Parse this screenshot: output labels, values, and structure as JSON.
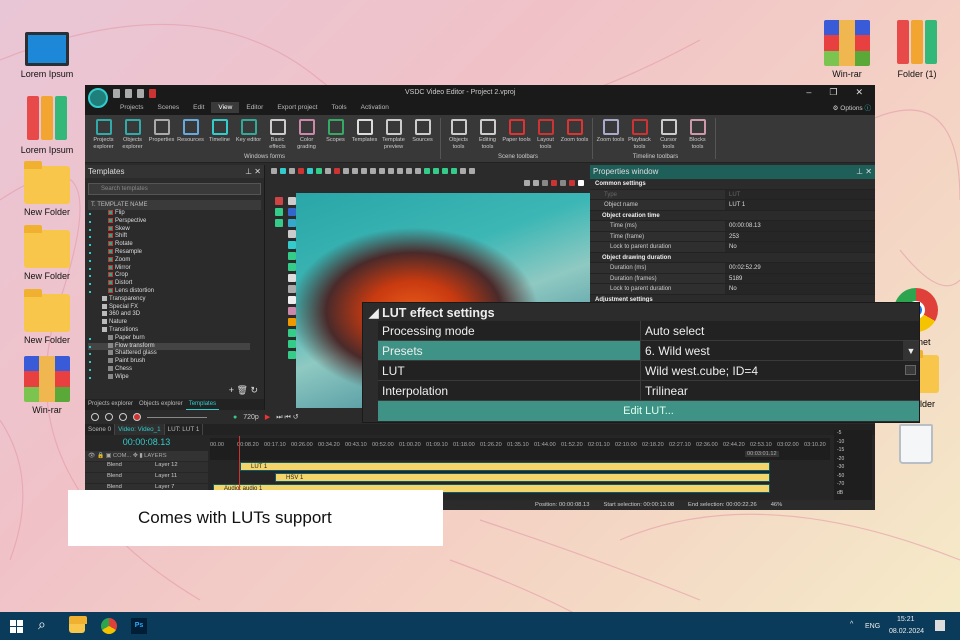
{
  "desktop": {
    "left_icons": [
      "Lorem Ipsum",
      "Lorem Ipsum",
      "New Folder",
      "New Folder",
      "New Folder",
      "Win-rar"
    ],
    "right_icons": [
      "Win-rar",
      "Folder (1)"
    ],
    "partial_icons": [
      "rnet",
      "older"
    ]
  },
  "window": {
    "title": "VSDC Video Editor - Project 2.vproj",
    "options": "Options",
    "menu_tabs": [
      "Projects",
      "Scenes",
      "Edit",
      "View",
      "Editor",
      "Export project",
      "Tools",
      "Activation"
    ],
    "ribbon": {
      "groups": [
        {
          "label": "Windows forms",
          "buttons": [
            "Projects explorer",
            "Objects explorer",
            "Properties",
            "Resources",
            "Timeline",
            "Key editor",
            "Basic effects",
            "Color grading",
            "Scopes",
            "Templates",
            "Template preview",
            "Sources"
          ]
        },
        {
          "label": "Scene toolbars",
          "buttons": [
            "Objects tools",
            "Editing tools",
            "Paper tools",
            "Layout tools",
            "Zoom tools"
          ]
        },
        {
          "label": "Timeline toolbars",
          "buttons": [
            "Zoom tools",
            "Playback tools",
            "Cursor tools",
            "Blocks tools"
          ]
        }
      ]
    }
  },
  "templates": {
    "title": "Templates",
    "search_placeholder": "Search templates",
    "col_t": "T.",
    "col_name": "TEMPLATE NAME",
    "items": [
      "Flip",
      "Perspective",
      "Skew",
      "Shift",
      "Rotate",
      "Resample",
      "Zoom",
      "Mirror",
      "Crop",
      "Distort",
      "Lens distortion",
      "Transparency",
      "Special FX",
      "360 and 3D",
      "Nature",
      "Transitions",
      "Paper burn",
      "Flow transform",
      "Shattered glass",
      "Paint brush",
      "Chess",
      "Wipe"
    ],
    "selected": "Flow transform",
    "tabs": [
      "Projects explorer",
      "Objects explorer",
      "Templates"
    ]
  },
  "properties": {
    "title": "Properties window",
    "rows": [
      {
        "type": "sec",
        "label": "Common settings"
      },
      {
        "k": "Type",
        "v": "LUT"
      },
      {
        "k": "Object name",
        "v": "LUT 1"
      },
      {
        "type": "sub",
        "label": "Object creation time"
      },
      {
        "k": "Time (ms)",
        "v": "00:00:08.13"
      },
      {
        "k": "Time (frame)",
        "v": "253"
      },
      {
        "k": "Lock to parent duration",
        "v": "No"
      },
      {
        "type": "sub",
        "label": "Object drawing duration"
      },
      {
        "k": "Duration (ms)",
        "v": "00:02:52.29"
      },
      {
        "k": "Duration (frames)",
        "v": "5189"
      },
      {
        "k": "Lock to parent duration",
        "v": "No"
      },
      {
        "type": "sec",
        "label": "Adjustment settings"
      }
    ]
  },
  "lut": {
    "title": "LUT effect settings",
    "processing_mode_label": "Processing mode",
    "processing_mode": "Auto select",
    "presets_label": "Presets",
    "presets": "6. Wild west",
    "lut_label": "LUT",
    "lut": "Wild west.cube; ID=4",
    "interpolation_label": "Interpolation",
    "interpolation": "Trilinear",
    "edit_button": "Edit LUT..."
  },
  "timeline": {
    "resolution": "720p",
    "scene_tabs": [
      "Scene 0",
      "Video: Video_1",
      "LUT: LUT 1"
    ],
    "timecode": "00:00:08.13",
    "ruler": [
      "00.00",
      "00:08.20",
      "00:17.10",
      "00:26.00",
      "00:34.20",
      "00:43.10",
      "00:52.00",
      "01:00.20",
      "01:09.10",
      "01:18.00",
      "01:26.20",
      "01:35.10",
      "01:44.00",
      "01:52.20",
      "02:01.10",
      "02:10.00",
      "02:18.20",
      "02:27.10",
      "02:36.00",
      "02:44.20",
      "02:53.10",
      "03:02.00",
      "03:10.20"
    ],
    "end_marker": "00:03:01.12",
    "header": {
      "com": "COM...",
      "layers": "LAYERS"
    },
    "layers": [
      {
        "blend": "Blend",
        "name": "Layer 12",
        "clip": "LUT 1"
      },
      {
        "blend": "Blend",
        "name": "Layer 11",
        "clip": "HSV 1"
      },
      {
        "blend": "Blend",
        "name": "Layer 7",
        "clip": "Audio: audio 1"
      }
    ],
    "status": {
      "position": "Position:  00:00:08.13",
      "start": "Start selection:  00:00:13.08",
      "end": "End selection:  00:00:22.26",
      "zoom": "46%"
    },
    "meter": [
      "-5",
      "-10",
      "-15",
      "-20",
      "-30",
      "-50",
      "-70",
      "dB"
    ]
  },
  "caption": "Comes with LUTs support",
  "taskbar": {
    "lang": "ENG",
    "time": "15:21",
    "date": "08.02.2024"
  }
}
